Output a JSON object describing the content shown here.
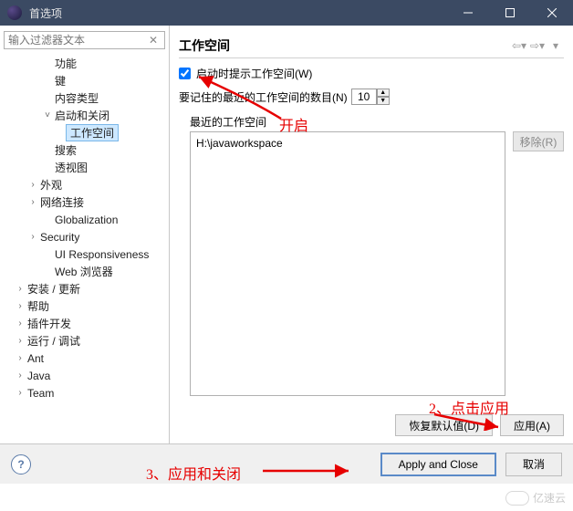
{
  "window": {
    "title": "首选项"
  },
  "sidebar": {
    "filter_placeholder": "输入过滤器文本",
    "items": [
      {
        "label": "功能",
        "level": 2,
        "twisty": ""
      },
      {
        "label": "键",
        "level": 2,
        "twisty": ""
      },
      {
        "label": "内容类型",
        "level": 2,
        "twisty": ""
      },
      {
        "label": "启动和关闭",
        "level": 2,
        "twisty": "˅"
      },
      {
        "label": "工作空间",
        "level": 3,
        "twisty": "",
        "selected": true
      },
      {
        "label": "搜索",
        "level": 2,
        "twisty": ""
      },
      {
        "label": "透视图",
        "level": 2,
        "twisty": ""
      },
      {
        "label": "外观",
        "level": 1,
        "twisty": "›"
      },
      {
        "label": "网络连接",
        "level": 1,
        "twisty": "›"
      },
      {
        "label": "Globalization",
        "level": 2,
        "twisty": ""
      },
      {
        "label": "Security",
        "level": 1,
        "twisty": "›"
      },
      {
        "label": "UI Responsiveness",
        "level": 2,
        "twisty": ""
      },
      {
        "label": "Web 浏览器",
        "level": 2,
        "twisty": ""
      },
      {
        "label": "安装 / 更新",
        "level": 0,
        "twisty": "›"
      },
      {
        "label": "帮助",
        "level": 0,
        "twisty": "›"
      },
      {
        "label": "插件开发",
        "level": 0,
        "twisty": "›"
      },
      {
        "label": "运行 / 调试",
        "level": 0,
        "twisty": "›"
      },
      {
        "label": "Ant",
        "level": 0,
        "twisty": "›"
      },
      {
        "label": "Java",
        "level": 0,
        "twisty": "›"
      },
      {
        "label": "Team",
        "level": 0,
        "twisty": "›"
      }
    ]
  },
  "page": {
    "heading": "工作空间",
    "checkbox_label": "启动时提示工作空间(W)",
    "checkbox_checked": true,
    "num_label": "要记住的最近的工作空间的数目(N)",
    "num_value": "10",
    "recent_label": "最近的工作空间",
    "recent_items": [
      "H:\\javaworkspace"
    ],
    "remove_label": "移除(R)",
    "restore_label": "恢复默认值(D)",
    "apply_label": "应用(A)"
  },
  "bottom": {
    "apply_close": "Apply and Close",
    "cancel": "取消"
  },
  "annotations": {
    "a1": "开启",
    "a2": "2、点击应用",
    "a3": "3、应用和关闭"
  },
  "watermark": "亿速云"
}
